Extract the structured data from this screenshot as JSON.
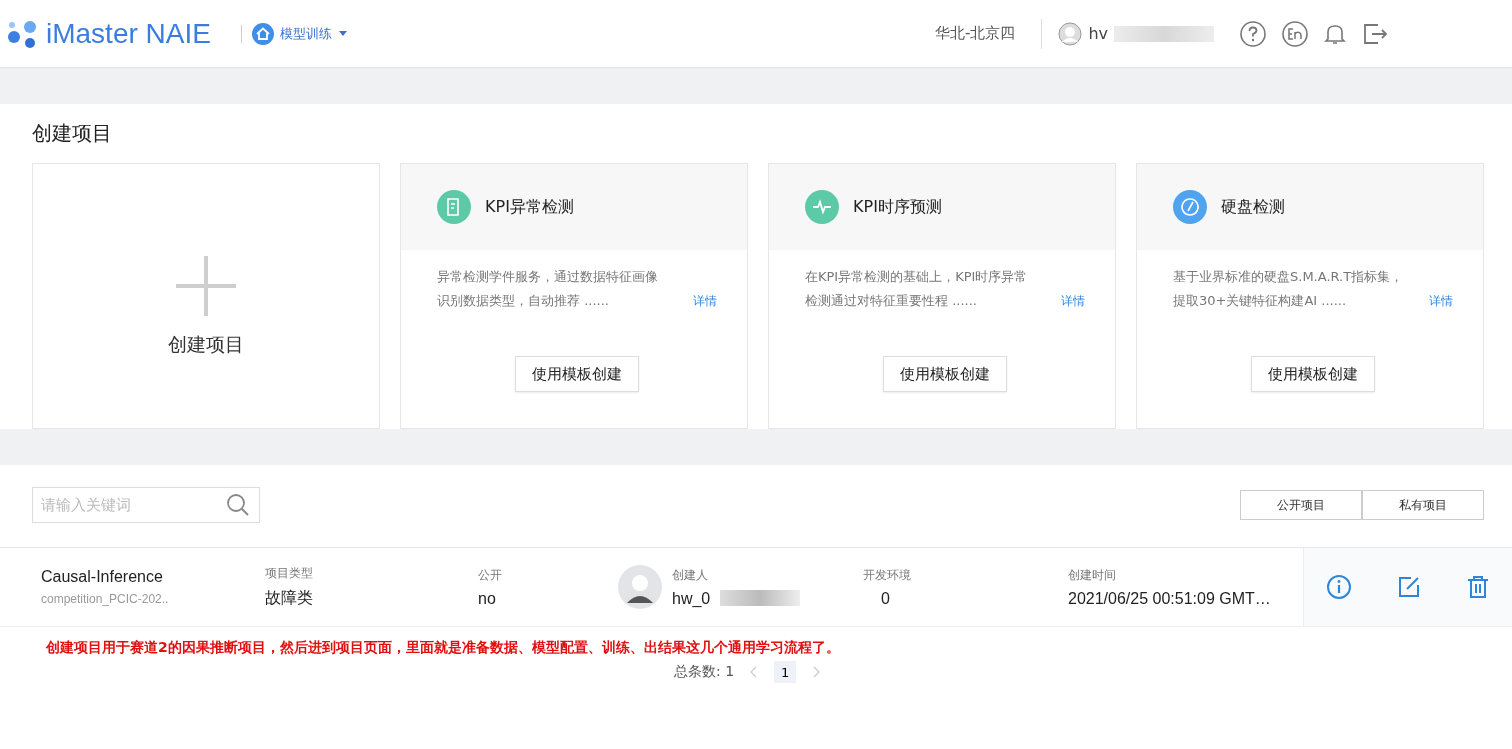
{
  "header": {
    "logo": "iMaster NAIE",
    "module": "模型训练",
    "region": "华北-北京四",
    "user": "hv"
  },
  "create_section": {
    "title": "创建项目",
    "blank_card": {
      "label": "创建项目"
    },
    "templates": [
      {
        "kind": "file",
        "title": "KPI异常检测",
        "lines": [
          "异常检测学件服务，通过数据特征画像",
          "识别数据类型，自动推荐 ......"
        ],
        "link": "详情",
        "button": "使用模板创建",
        "color": "#5cc9a7"
      },
      {
        "kind": "pulse",
        "title": "KPI时序预测",
        "lines": [
          "在KPI异常检测的基础上，KPI时序异常",
          "检测通过对特征重要性程 ......"
        ],
        "link": "详情",
        "button": "使用模板创建",
        "color": "#5cc9a7"
      },
      {
        "kind": "disk",
        "title": "硬盘检测",
        "lines": [
          "基于业界标准的硬盘S.M.A.R.T指标集，",
          "提取30+关键特征构建AI ......"
        ],
        "link": "详情",
        "button": "使用模板创建",
        "color": "#4fa3ef"
      }
    ]
  },
  "list_section": {
    "search": {
      "placeholder": "请输入关键词"
    },
    "filters": [
      "公开项目",
      "私有项目"
    ],
    "rows": [
      {
        "name": "Causal-Inference",
        "subtitle": "competition_PCIC-202..",
        "type_label": "项目类型",
        "type": "故障类",
        "public_label": "公开",
        "public": "no",
        "creator_label": "创建人",
        "creator": "hw_0",
        "env_label": "开发环境",
        "env": "0",
        "time_label": "创建时间",
        "time": "2021/06/25 00:51:09 GMT…"
      }
    ],
    "total": "总条数: 1",
    "pages": [
      {
        "label": "1",
        "selected": true
      }
    ]
  },
  "annotation": "创建项目用于赛道2的因果推断项目，然后进到项目页面，里面就是准备数据、模型配置、训练、出结果这几个通用学习流程了。"
}
